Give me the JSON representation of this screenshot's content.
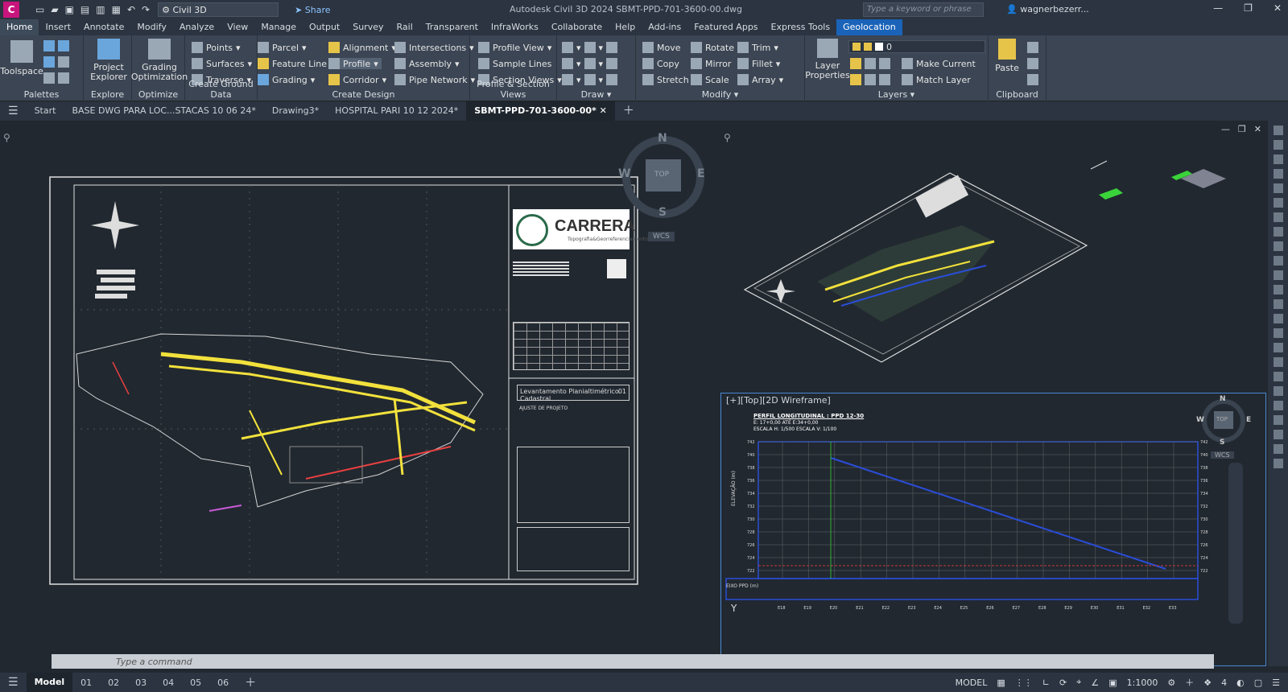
{
  "titlebar": {
    "app_letter": "C",
    "workspace": "Civil 3D",
    "share": "Share",
    "doc_title": "Autodesk Civil 3D 2024   SBMT-PPD-701-3600-00.dwg",
    "search_placeholder": "Type a keyword or phrase",
    "user": "wagnerbezerr..."
  },
  "ribbon_tabs": [
    "Home",
    "Insert",
    "Annotate",
    "Modify",
    "Analyze",
    "View",
    "Manage",
    "Output",
    "Survey",
    "Rail",
    "Transparent",
    "InfraWorks",
    "Collaborate",
    "Help",
    "Add-ins",
    "Featured Apps",
    "Express Tools",
    "Geolocation"
  ],
  "ribbon": {
    "palettes": {
      "title": "Palettes",
      "toolspace": "Toolspace"
    },
    "explore": {
      "title": "Explore",
      "project_explorer": "Project Explorer"
    },
    "optimize": {
      "title": "Optimize",
      "grading_opt": "Grading Optimization"
    },
    "ground": {
      "title": "Create Ground Data",
      "points": "Points",
      "surfaces": "Surfaces",
      "traverse": "Traverse"
    },
    "design": {
      "title": "Create Design",
      "parcel": "Parcel",
      "feature_line": "Feature Line",
      "grading": "Grading",
      "alignment": "Alignment",
      "profile": "Profile",
      "corridor": "Corridor",
      "intersections": "Intersections",
      "assembly": "Assembly",
      "pipe_network": "Pipe Network"
    },
    "psv": {
      "title": "Profile & Section Views",
      "profile_view": "Profile View",
      "sample_lines": "Sample Lines",
      "section_views": "Section Views"
    },
    "draw": {
      "title": "Draw"
    },
    "modify": {
      "title": "Modify",
      "move": "Move",
      "rotate": "Rotate",
      "trim": "Trim",
      "copy": "Copy",
      "mirror": "Mirror",
      "fillet": "Fillet",
      "stretch": "Stretch",
      "scale": "Scale",
      "array": "Array"
    },
    "layers": {
      "title": "Layers",
      "layer_properties": "Layer Properties",
      "layer_value": "0",
      "make_current": "Make Current",
      "match_layer": "Match Layer"
    },
    "clipboard": {
      "title": "Clipboard",
      "paste": "Paste"
    }
  },
  "file_tabs": [
    "Start",
    "BASE DWG PARA LOC...STACAS 10 06 24*",
    "Drawing3*",
    "HOSPITAL PARI 10 12 2024*",
    "SBMT-PPD-701-3600-00*"
  ],
  "viewports": {
    "left": {
      "compass_n": "N",
      "compass_e": "E",
      "compass_s": "S",
      "compass_w": "W",
      "cube": "TOP",
      "wcs": "WCS",
      "logo_text": "CARRERA",
      "logo_sub": "Topografia&Georreferenciamento",
      "box_title": "Levantamento Planialtimétrico Cadastral",
      "box_num": "01",
      "ajuste": "AJUSTE DE PROJETO"
    },
    "bottom_right": {
      "label": "[+][Top][2D Wireframe]",
      "compass_n": "N",
      "compass_e": "E",
      "compass_s": "S",
      "compass_w": "W",
      "cube": "TOP",
      "wcs": "WCS",
      "profile_title": "PERFIL LONGITUDINAL : PPD 12-30",
      "profile_sub1": "E: 17+0,00 ATÉ E:34+0,00",
      "profile_sub2": "ESCALA H: 1/500  ESCALA V: 1/100",
      "ylabel": "ELEVAÇÃO (m)",
      "yaxis_y": "Y",
      "eixo": "EIXO PPD (m)",
      "y_ticks": [
        "742",
        "740",
        "738",
        "736",
        "734",
        "732",
        "730",
        "728",
        "726",
        "724",
        "722"
      ],
      "x_ticks": [
        "E18",
        "E19",
        "E20",
        "E21",
        "E22",
        "E23",
        "E24",
        "E25",
        "E26",
        "E27",
        "E28",
        "E29",
        "E30",
        "E31",
        "E32",
        "E33"
      ]
    }
  },
  "cmdline": {
    "placeholder": "Type a command"
  },
  "layout_tabs": [
    "Model",
    "01",
    "02",
    "03",
    "04",
    "05",
    "06"
  ],
  "status": {
    "model": "MODEL",
    "scale": "1:1000",
    "num": "4"
  }
}
